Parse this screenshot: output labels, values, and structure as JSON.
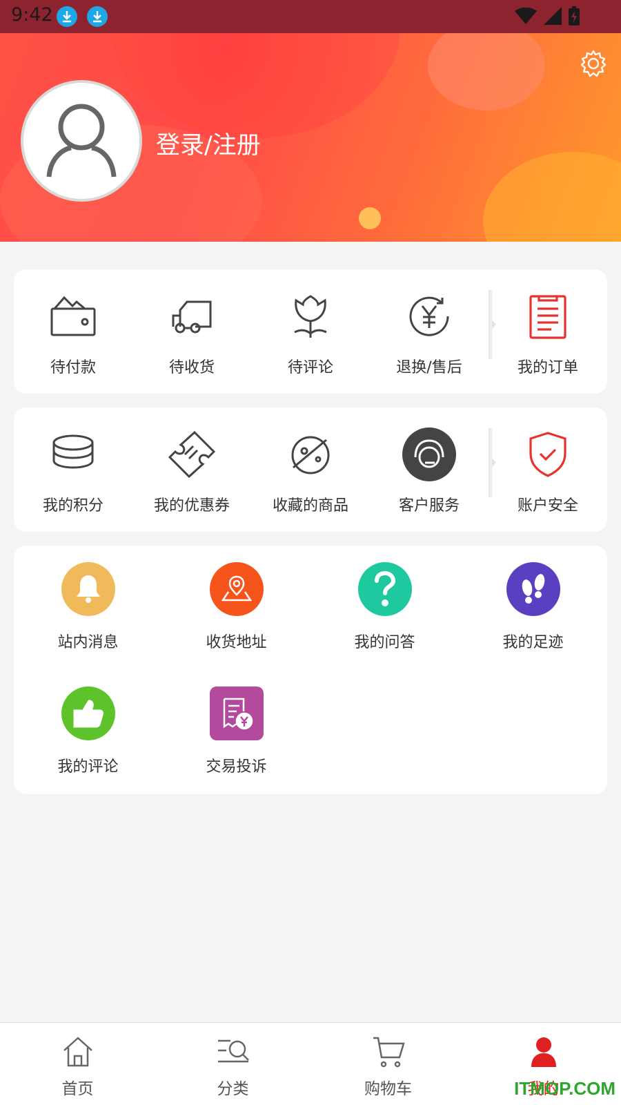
{
  "status_bar": {
    "time": "9:42"
  },
  "header": {
    "login_label": "登录/注册"
  },
  "orders": [
    {
      "label": "待付款",
      "icon": "wallet-icon"
    },
    {
      "label": "待收货",
      "icon": "truck-icon"
    },
    {
      "label": "待评论",
      "icon": "tulip-icon"
    },
    {
      "label": "退换/售后",
      "icon": "yuan-refund-icon"
    },
    {
      "label": "我的订单",
      "icon": "clipboard-icon"
    }
  ],
  "services": [
    {
      "label": "我的积分",
      "icon": "coins-icon"
    },
    {
      "label": "我的优惠券",
      "icon": "ticket-icon"
    },
    {
      "label": "收藏的商品",
      "icon": "planet-icon"
    },
    {
      "label": "客户服务",
      "icon": "headset-icon"
    },
    {
      "label": "账户安全",
      "icon": "shield-check-icon"
    }
  ],
  "tools": [
    {
      "label": "站内消息",
      "icon": "bell-icon",
      "color": "#f0b95a"
    },
    {
      "label": "收货地址",
      "icon": "map-pin-icon",
      "color": "#f5541b"
    },
    {
      "label": "我的问答",
      "icon": "question-icon",
      "color": "#1fc9a0"
    },
    {
      "label": "我的足迹",
      "icon": "footprints-icon",
      "color": "#5a3fc0"
    },
    {
      "label": "我的评论",
      "icon": "thumbs-up-icon",
      "color": "#5ec32a"
    },
    {
      "label": "交易投诉",
      "icon": "receipt-yuan-icon",
      "color": "#b34a9d"
    }
  ],
  "tabbar": [
    {
      "label": "首页",
      "icon": "home-icon"
    },
    {
      "label": "分类",
      "icon": "category-search-icon"
    },
    {
      "label": "购物车",
      "icon": "cart-icon"
    },
    {
      "label": "我的",
      "icon": "user-icon",
      "active": true
    }
  ],
  "watermark": "ITMOP.COM"
}
